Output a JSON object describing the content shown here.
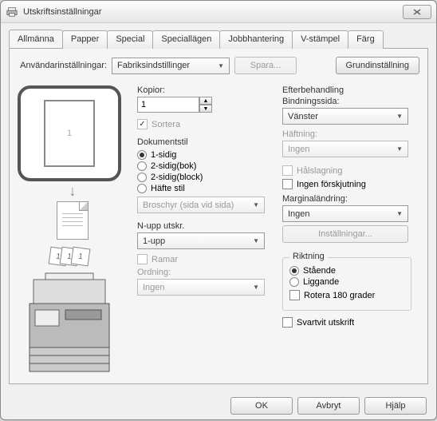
{
  "window": {
    "title": "Utskriftsinställningar"
  },
  "tabs": {
    "general": "Allmänna",
    "paper": "Papper",
    "special": "Special",
    "special_modes": "Speciallägen",
    "job": "Jobbhantering",
    "vstamp": "V-stämpel",
    "color": "Färg"
  },
  "top": {
    "user_settings_label": "Användarinställningar:",
    "user_settings_value": "Fabriksindstillinger",
    "save_label": "Spara...",
    "defaults_label": "Grundinställning"
  },
  "preview": {
    "page_num": "1",
    "layer1": "1",
    "layer2": "1",
    "layer3": "1"
  },
  "copies": {
    "label": "Kopior:",
    "value": "1",
    "collate_label": "Sortera"
  },
  "docstyle": {
    "title": "Dokumentstil",
    "opt1": "1-sidig",
    "opt2": "2-sidig(bok)",
    "opt3": "2-sidig(block)",
    "opt4": "Häfte stil",
    "pamphlet_label": "Broschyr (sida vid sida)"
  },
  "nup": {
    "title": "N-upp utskr.",
    "value": "1-upp",
    "frame_label": "Ramar",
    "order_label": "Ordning:",
    "order_value": "Ingen"
  },
  "finishing": {
    "title": "Efterbehandling",
    "binding_label": "Bindningssida:",
    "binding_value": "Vänster",
    "staple_label": "Häftning:",
    "staple_value": "Ingen",
    "punch_label": "Hålslagning",
    "offset_label": "Ingen förskjutning",
    "margin_label": "Marginaländring:",
    "margin_value": "Ingen",
    "settings_label": "Inställningar..."
  },
  "orientation": {
    "title": "Riktning",
    "portrait": "Stående",
    "landscape": "Liggande",
    "rotate": "Rotera 180 grader"
  },
  "bw": {
    "label": "Svartvit utskrift"
  },
  "buttons": {
    "ok": "OK",
    "cancel": "Avbryt",
    "help": "Hjälp"
  }
}
